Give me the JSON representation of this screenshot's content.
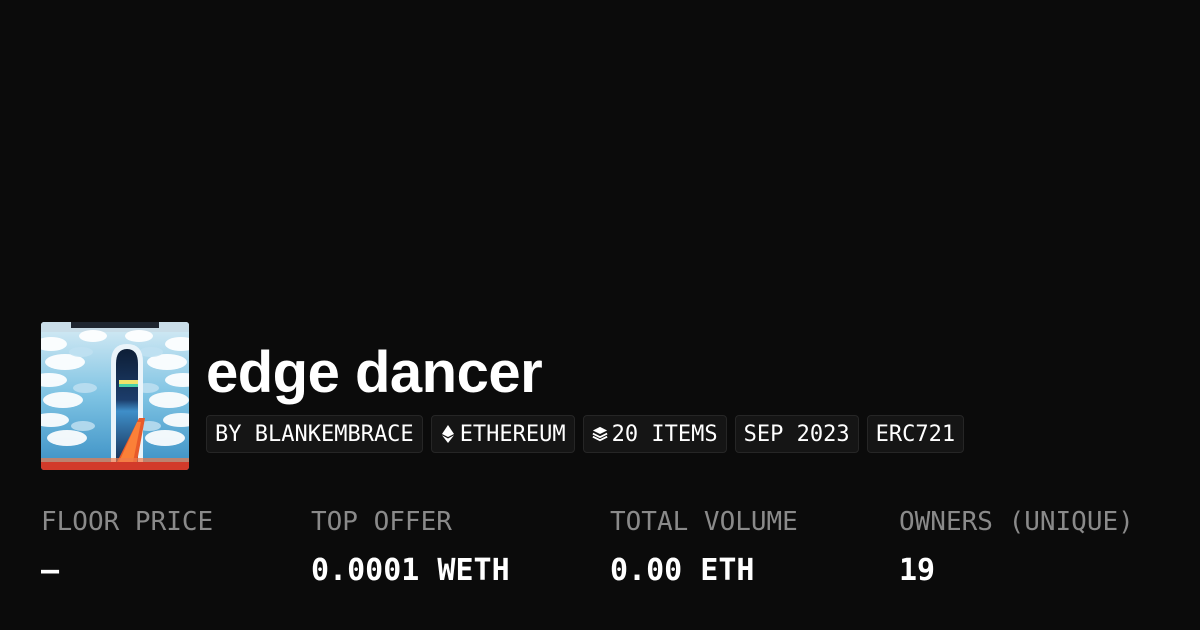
{
  "collection": {
    "title": "edge dancer",
    "image_icon": "collection-artwork-clouds-doorway"
  },
  "tags": {
    "creator": "BY BLANKEMBRACE",
    "chain": "ETHEREUM",
    "chain_icon": "ethereum-icon",
    "items": "20 ITEMS",
    "items_icon": "layers-icon",
    "date": "SEP 2023",
    "standard": "ERC721"
  },
  "stats": {
    "floor_price": {
      "label": "FLOOR PRICE",
      "value": "–"
    },
    "top_offer": {
      "label": "TOP OFFER",
      "value": "0.0001 WETH"
    },
    "total_volume": {
      "label": "TOTAL VOLUME",
      "value": "0.00 ETH"
    },
    "owners": {
      "label": "OWNERS (UNIQUE)",
      "value": "19"
    }
  },
  "colors": {
    "background": "#0b0b0b",
    "text_primary": "#ffffff",
    "text_muted": "#8a8a8a",
    "tag_background": "#151515",
    "tag_border": "#262626"
  }
}
